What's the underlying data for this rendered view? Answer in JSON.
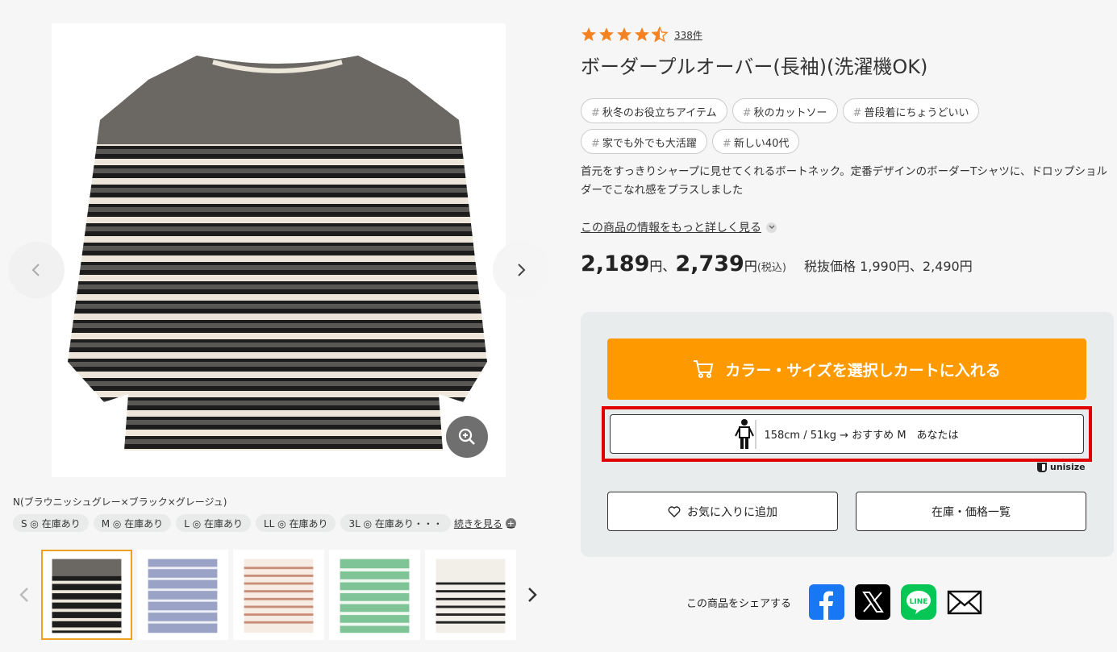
{
  "product": {
    "review_count": "338件",
    "rating_stars": 4.5,
    "title": "ボーダープルオーバー(長袖)(洗濯機OK)",
    "tags": [
      {
        "hash": "#",
        "label": "秋冬のお役立ちアイテム"
      },
      {
        "hash": "#",
        "label": "秋のカットソー"
      },
      {
        "hash": "#",
        "label": "普段着にちょうどいい"
      },
      {
        "hash": "#",
        "label": "家でも外でも大活躍"
      },
      {
        "hash": "#",
        "label": "新しい40代"
      }
    ],
    "description": "首元をすっきりシャープに見せてくれるボートネック。定番デザインのボーダーTシャツに、ドロップショルダーでこなれ感をプラスしました",
    "more_info": "この商品の情報をもっと詳しく見る"
  },
  "price": {
    "low": "2,189",
    "yen1": "円、",
    "high": "2,739",
    "yen2": "円",
    "tax": "(税込)",
    "excl_label": "税抜価格 1,990円、2,490円"
  },
  "gallery": {
    "color_name": "N(ブラウニッシュグレー×ブラック×グレージュ)",
    "sizes": [
      "S ◎ 在庫あり",
      "M ◎ 在庫あり",
      "L ◎ 在庫あり",
      "LL ◎ 在庫あり",
      "3L ◎ 在庫あり・・・"
    ],
    "see_more": "続きを見る",
    "thumb_colors": [
      "#6b6864",
      "#9aa3c6",
      "#c98e78",
      "#7fc497",
      "#f2efe8"
    ]
  },
  "cart": {
    "add_to_cart": "カラー・サイズを選択しカートに入れる",
    "size_rec": "158cm / 51kg → おすすめ M　あなたは",
    "unisize_label": "unisize",
    "favorite": "お気に入りに追加",
    "stock": "在庫・価格一覧"
  },
  "share": {
    "label": "この商品をシェアする",
    "icons": [
      "facebook-icon",
      "x-icon",
      "line-icon",
      "mail-icon"
    ]
  },
  "colors": {
    "accent": "#fe9a00",
    "star": "#f58220",
    "highlight_frame": "#e00000"
  }
}
